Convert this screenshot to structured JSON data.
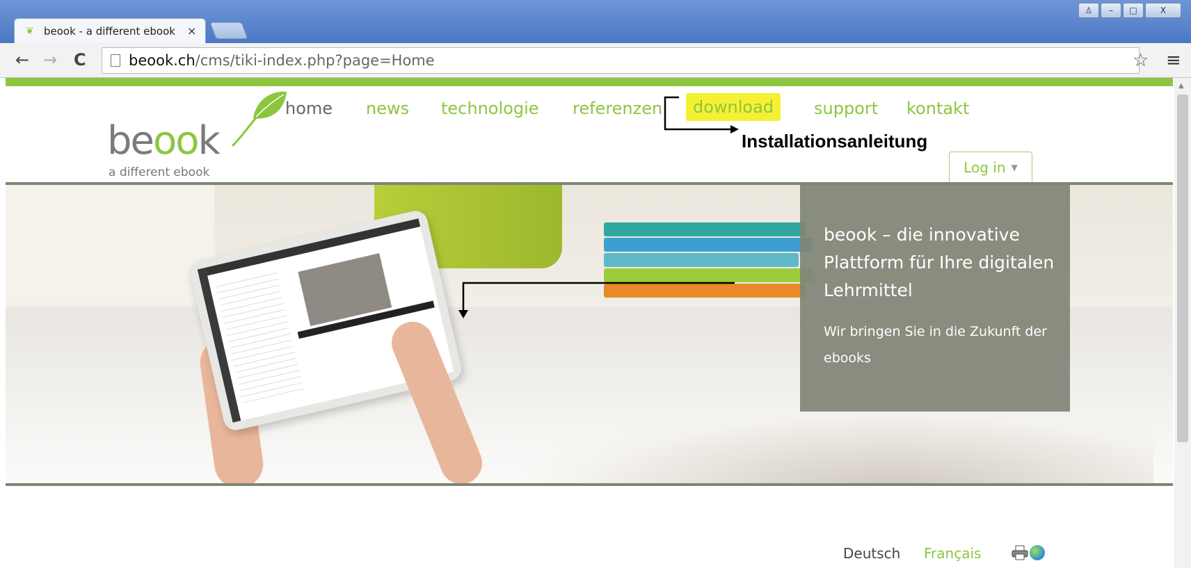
{
  "browser": {
    "tab_title": "beook - a different ebook",
    "tab_close": "×",
    "url_host": "beook.ch",
    "url_path": "/cms/tiki-index.php?page=Home",
    "nav": {
      "back": "←",
      "forward": "→",
      "reload": "C"
    },
    "star": "☆",
    "menu": "≡",
    "window_controls": {
      "user": "♙",
      "minimize": "–",
      "maximize": "□",
      "close": "X"
    }
  },
  "site": {
    "logo": {
      "word_prefix": "be",
      "word_oo": "oo",
      "word_suffix": "k",
      "tagline": "a different ebook"
    },
    "nav": [
      {
        "label": "home",
        "active": true
      },
      {
        "label": "news"
      },
      {
        "label": "technologie"
      },
      {
        "label": "referenzen"
      },
      {
        "label": "download",
        "highlighted": true
      },
      {
        "label": "support"
      },
      {
        "label": "kontakt"
      }
    ],
    "annotation": "Installationsanleitung",
    "login": {
      "label": "Log in",
      "caret": "▼"
    },
    "hero": {
      "headline": "beook – die innovative Plattform für Ihre digitalen Lehrmittel",
      "subline": "Wir bringen Sie in die Zukunft der ebooks"
    },
    "languages": {
      "de": "Deutsch",
      "fr": "Français"
    },
    "icons": [
      "print-icon",
      "globe-icon"
    ]
  },
  "colors": {
    "brand_green": "#8cc63f",
    "highlight_yellow": "#f6f035",
    "hero_box": "#808576",
    "chrome_blue": "#5a84cc"
  }
}
